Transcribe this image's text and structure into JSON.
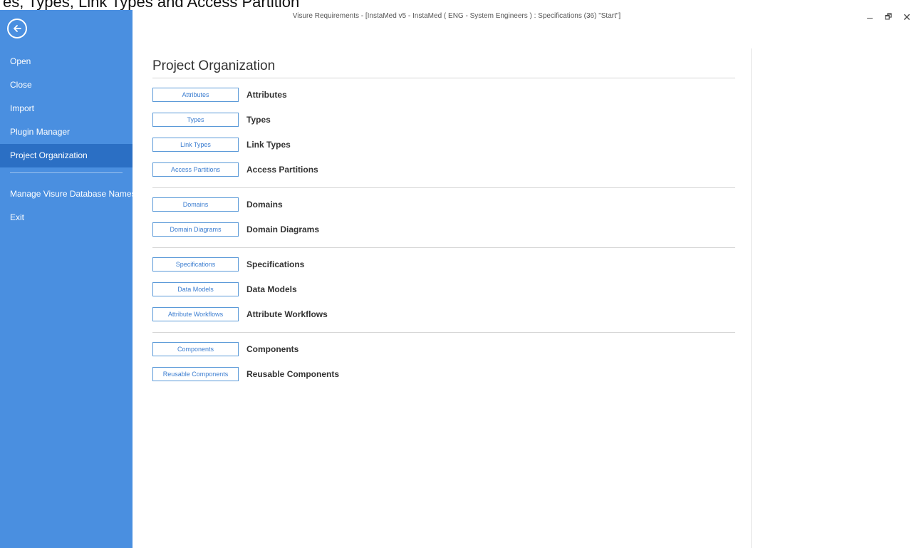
{
  "top_strip_text": "es, Types, Link Types and Access Partitions into an existing",
  "window": {
    "title": "Visure Requirements - [InstaMed v5 - InstaMed ( ENG - System Engineers ) : Specifications (36) \"Start\"]",
    "minimize_glyph": "–",
    "restore_glyph": "🗗",
    "close_glyph": "✕"
  },
  "sidebar": {
    "back_icon": "back-arrow-circle-icon",
    "items": [
      {
        "label": "Open"
      },
      {
        "label": "Close"
      },
      {
        "label": "Import"
      },
      {
        "label": "Plugin Manager"
      },
      {
        "label": "Project Organization"
      },
      {
        "label": "Manage Visure Database Names"
      },
      {
        "label": "Exit"
      }
    ],
    "active_index": 4,
    "colors": {
      "background": "#4a8fe0",
      "active": "#2b6fc4"
    }
  },
  "content": {
    "title": "Project Organization",
    "rows": [
      {
        "button": "Attributes",
        "label": "Attributes"
      },
      {
        "button": "Types",
        "label": "Types"
      },
      {
        "button": "Link Types",
        "label": "Link Types"
      },
      {
        "button": "Access Partitions",
        "label": "Access Partitions"
      },
      {
        "button": "Domains",
        "label": "Domains"
      },
      {
        "button": "Domain Diagrams",
        "label": "Domain Diagrams"
      },
      {
        "button": "Specifications",
        "label": "Specifications"
      },
      {
        "button": "Data Models",
        "label": "Data Models"
      },
      {
        "button": "Attribute Workflows",
        "label": "Attribute Workflows"
      },
      {
        "button": "Components",
        "label": "Components"
      },
      {
        "button": "Reusable Components",
        "label": "Reusable Components"
      }
    ],
    "colors": {
      "button_border": "#5b9ad8",
      "button_text": "#3b7dd0"
    }
  }
}
